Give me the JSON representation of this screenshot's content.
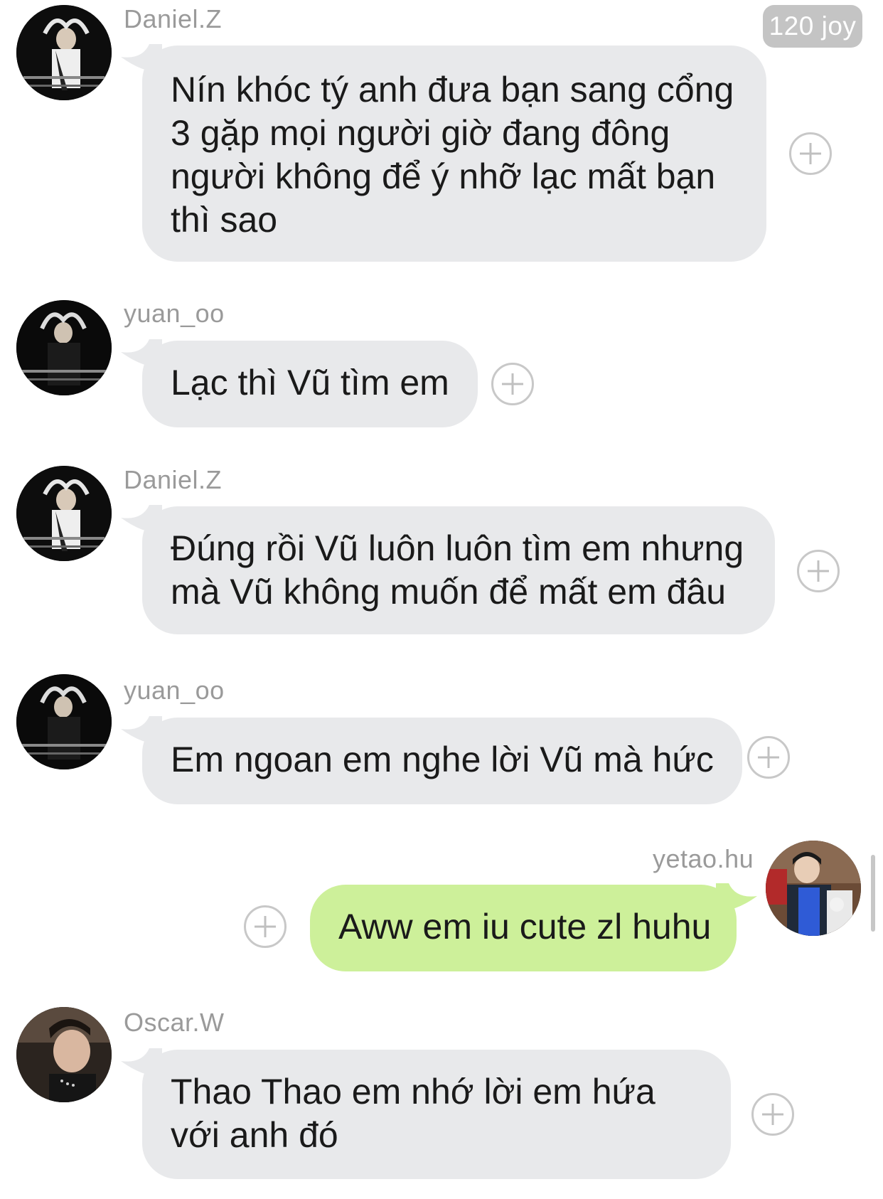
{
  "badge": {
    "label": "120 joy"
  },
  "messages": [
    {
      "sender": "Daniel.Z",
      "text": "Nín khóc tý anh đưa bạn sang cổng 3 gặp mọi người giờ đang đông người không để ý nhỡ lạc mất bạn thì sao",
      "outgoing": false,
      "avatar": "daniel-z-avatar"
    },
    {
      "sender": "yuan_oo",
      "text": "Lạc thì Vũ tìm em",
      "outgoing": false,
      "avatar": "yuan-oo-avatar"
    },
    {
      "sender": "Daniel.Z",
      "text": "Đúng rồi Vũ luôn luôn tìm em nhưng mà Vũ không muốn để mất em đâu",
      "outgoing": false,
      "avatar": "daniel-z-avatar"
    },
    {
      "sender": "yuan_oo",
      "text": "Em ngoan em nghe lời Vũ mà hức",
      "outgoing": false,
      "avatar": "yuan-oo-avatar"
    },
    {
      "sender": "yetao.hu",
      "text": "Aww em iu cute zl huhu",
      "outgoing": true,
      "avatar": "yetao-hu-avatar"
    },
    {
      "sender": "Oscar.W",
      "text": "Thao Thao em nhớ lời em hứa với anh đó",
      "outgoing": false,
      "avatar": "oscar-w-avatar"
    }
  ],
  "colors": {
    "incoming_bubble": "#e8e9eb",
    "outgoing_bubble": "#cdf09a",
    "name_text": "#9a9a9a",
    "badge_bg": "#c4c4c4"
  }
}
